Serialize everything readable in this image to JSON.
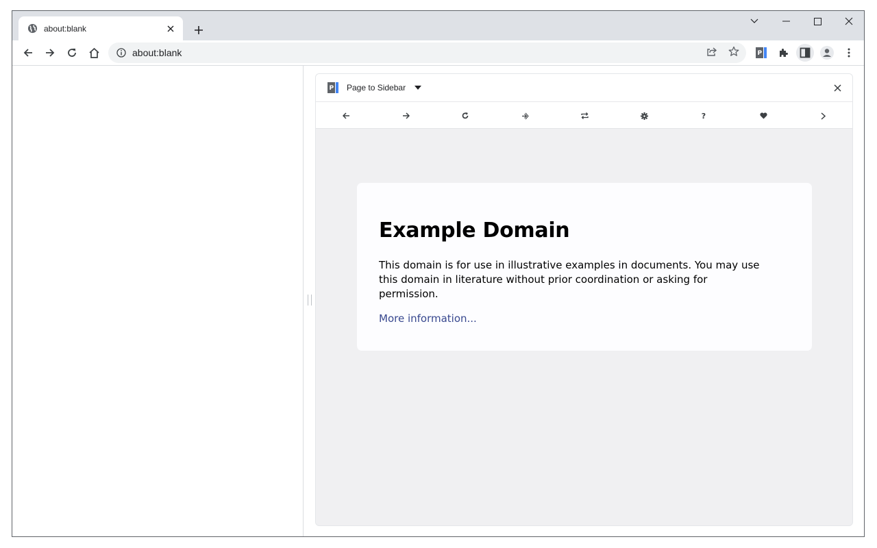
{
  "browser": {
    "tab": {
      "title": "about:blank",
      "favicon": "globe-icon"
    },
    "omnibox": {
      "url": "about:blank"
    },
    "colors": {
      "titlebar": "#dee1e6",
      "omnibox": "#f1f3f4",
      "accent": "#4285f4"
    }
  },
  "side_panel": {
    "title": "Page to Sidebar",
    "nav_icons": [
      "back-icon",
      "forward-icon",
      "reload-icon",
      "open-in-page-icon",
      "swap-icon",
      "settings-icon",
      "help-icon",
      "heart-icon",
      "next-icon"
    ],
    "nav_glyphs": {
      "help": "?"
    }
  },
  "page": {
    "heading": "Example Domain",
    "paragraph": "This domain is for use in illustrative examples in documents. You may use this domain in literature without prior coordination or asking for permission.",
    "link": "More information...",
    "link_color": "#38488f",
    "background": "#f0f0f2"
  }
}
